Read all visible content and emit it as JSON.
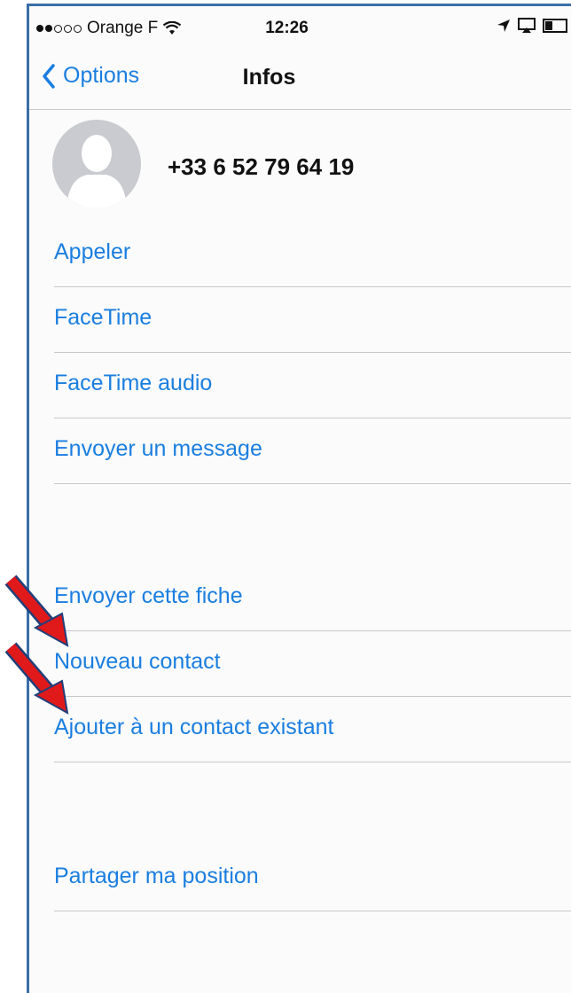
{
  "status_bar": {
    "carrier": "Orange F",
    "time": "12:26"
  },
  "nav": {
    "back_label": "Options",
    "title": "Infos"
  },
  "contact": {
    "phone": "+33 6 52 79 64 19"
  },
  "actions_group1": [
    "Appeler",
    "FaceTime",
    "FaceTime audio",
    "Envoyer un message"
  ],
  "actions_group2": [
    "Envoyer cette fiche",
    "Nouveau contact",
    "Ajouter à un contact existant"
  ],
  "actions_group3": [
    "Partager ma position"
  ],
  "colors": {
    "accent": "#1a7ee0",
    "annotation_arrow": "#e0191b"
  }
}
